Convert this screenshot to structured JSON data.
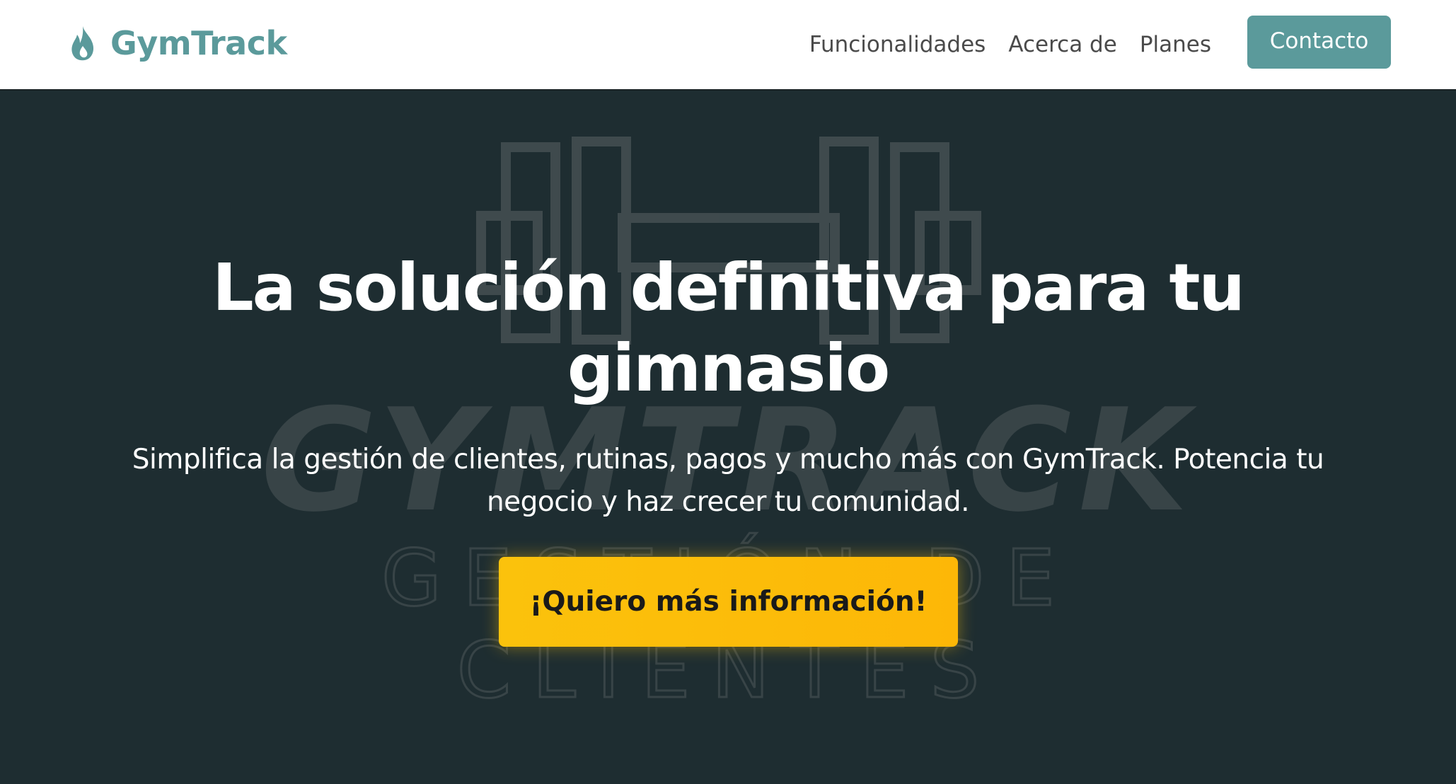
{
  "brand": {
    "name": "GymTrack",
    "icon": "flame-icon",
    "color": "#5b9a9b"
  },
  "nav": {
    "links": [
      {
        "label": "Funcionalidades"
      },
      {
        "label": "Acerca de"
      },
      {
        "label": "Planes"
      }
    ],
    "contact_label": "Contacto"
  },
  "hero": {
    "title": "La solución definitiva para tu gimnasio",
    "subtitle": "Simplifica la gestión de clientes, rutinas, pagos y mucho más con GymTrack. Potencia tu negocio y haz crecer tu comunidad.",
    "cta_label": "¡Quiero más información!",
    "background_icon": "dumbbell-icon",
    "background_logo": {
      "title": "GYMTRACK",
      "tagline_line1": "GESTIÓN DE",
      "tagline_line2": "CLIENTES"
    }
  },
  "colors": {
    "accent": "#5b9a9b",
    "hero_bg": "#1e2d31",
    "cta": "#fbc20c",
    "nav_bg": "#ffffff"
  }
}
